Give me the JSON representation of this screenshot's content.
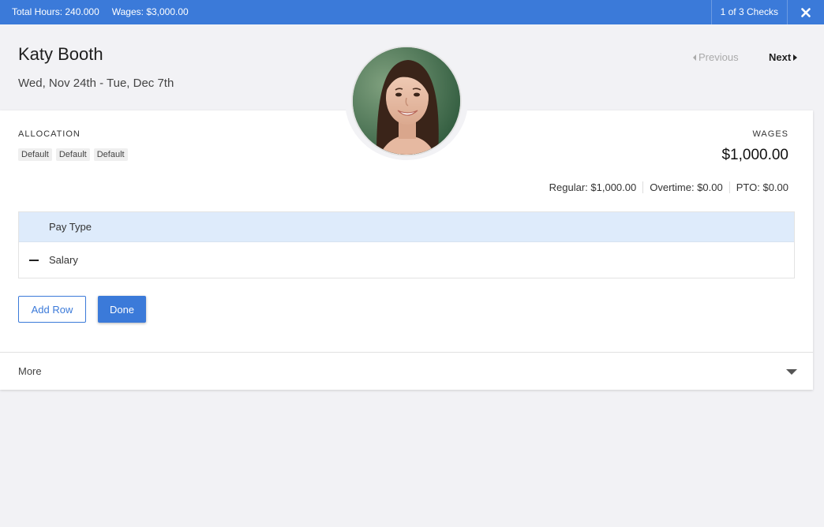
{
  "topbar": {
    "total_hours": "Total Hours: 240.000",
    "wages": "Wages: $3,000.00",
    "checks_counter": "1 of 3 Checks",
    "close_icon": "close-icon"
  },
  "employee": {
    "name": "Katy Booth",
    "date_range": "Wed, Nov 24th - Tue, Dec 7th",
    "avatar": "avatar-photo"
  },
  "navigation": {
    "previous_label": "Previous",
    "next_label": "Next"
  },
  "allocation": {
    "label": "ALLOCATION",
    "tags": [
      "Default",
      "Default",
      "Default"
    ]
  },
  "wages": {
    "label": "WAGES",
    "amount": "$1,000.00",
    "breakdown": {
      "regular": "Regular: $1,000.00",
      "overtime": "Overtime: $0.00",
      "pto": "PTO: $0.00"
    }
  },
  "pay_table": {
    "header": "Pay Type",
    "rows": [
      {
        "pay_type": "Salary"
      }
    ]
  },
  "actions": {
    "add_row_label": "Add Row",
    "done_label": "Done"
  },
  "more": {
    "label": "More"
  },
  "colors": {
    "accent": "#3b7ad9",
    "table_header_bg": "#deebfb",
    "page_bg": "#f2f2f5"
  }
}
